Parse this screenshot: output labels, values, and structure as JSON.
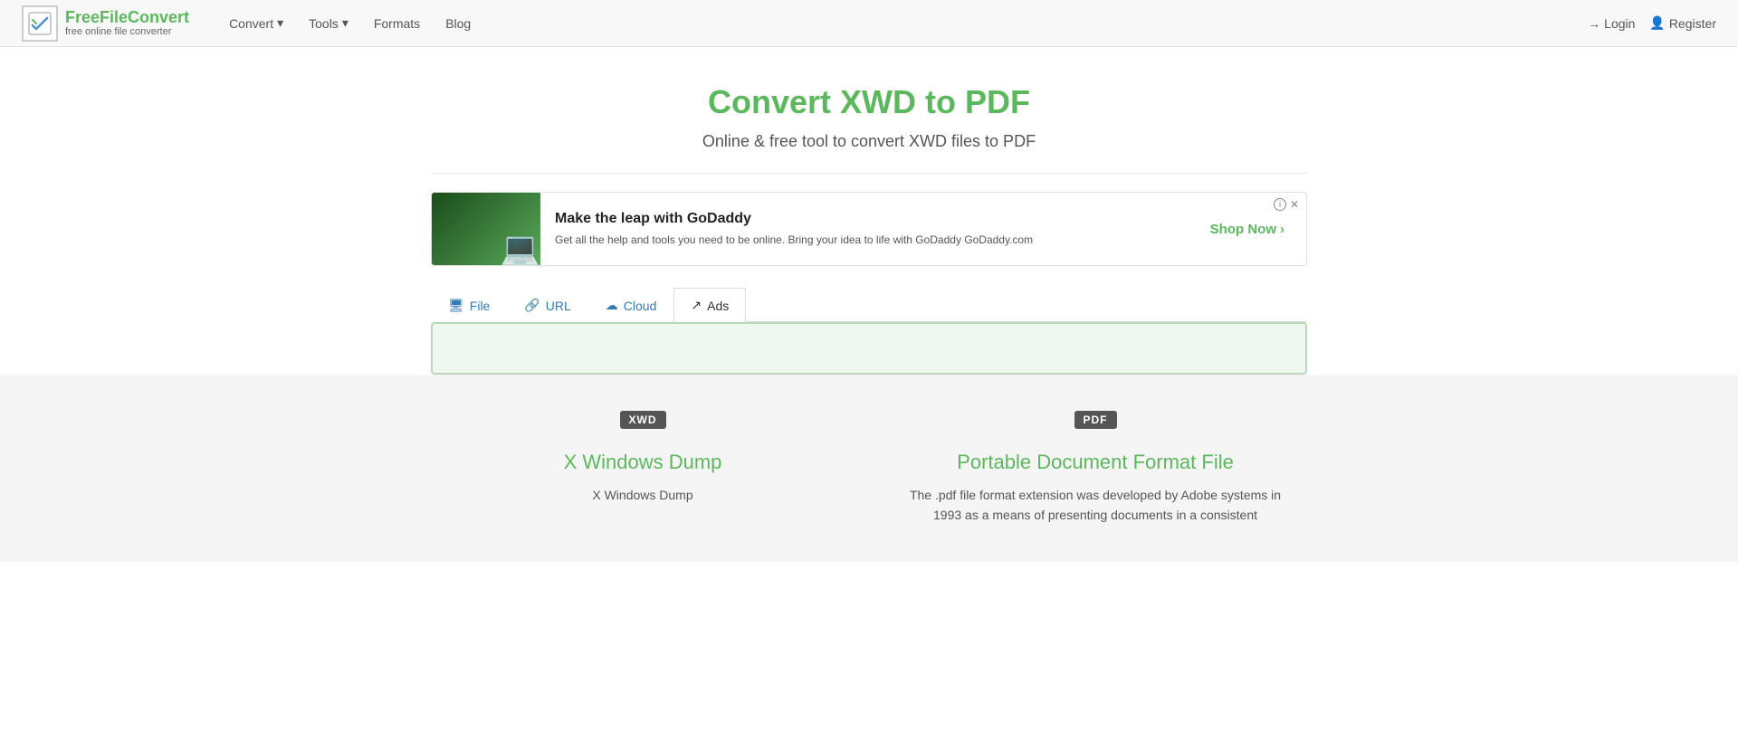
{
  "brand": {
    "name_prefix": "Free",
    "name_main": "FileConvert",
    "tagline": "free online file converter",
    "logo_icon": "✓"
  },
  "navbar": {
    "convert_label": "Convert",
    "tools_label": "Tools",
    "formats_label": "Formats",
    "blog_label": "Blog",
    "login_label": "Login",
    "register_label": "Register"
  },
  "page": {
    "title": "Convert XWD to PDF",
    "subtitle": "Online & free tool to convert XWD files to PDF"
  },
  "ad": {
    "headline": "Make the leap with GoDaddy",
    "description": "Get all the help and tools you need to be online. Bring your idea to life with GoDaddy GoDaddy.com",
    "cta_label": "Shop Now"
  },
  "tabs": [
    {
      "id": "file",
      "label": "File",
      "icon": "monitor"
    },
    {
      "id": "url",
      "label": "URL",
      "icon": "link"
    },
    {
      "id": "cloud",
      "label": "Cloud",
      "icon": "cloud"
    },
    {
      "id": "ads",
      "label": "Ads",
      "icon": "external"
    }
  ],
  "formats": [
    {
      "badge": "XWD",
      "name": "X Windows Dump",
      "description": "X Windows Dump"
    },
    {
      "badge": "PDF",
      "name": "Portable Document Format File",
      "description": "The .pdf file format extension was developed by Adobe systems in 1993 as a means of presenting documents in a consistent"
    }
  ]
}
